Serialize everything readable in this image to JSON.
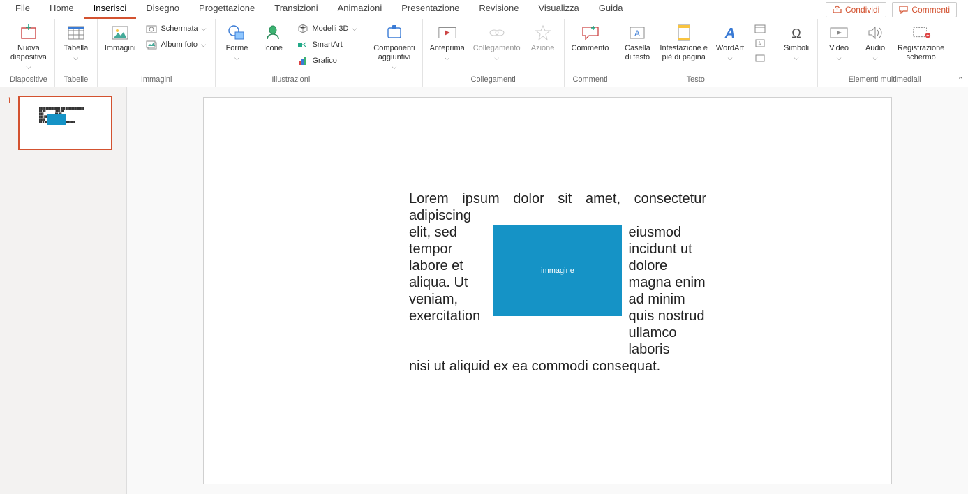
{
  "tabs": {
    "items": [
      "File",
      "Home",
      "Inserisci",
      "Disegno",
      "Progettazione",
      "Transizioni",
      "Animazioni",
      "Presentazione",
      "Revisione",
      "Visualizza",
      "Guida"
    ],
    "active_index": 2
  },
  "share_label": "Condividi",
  "comments_label": "Commenti",
  "ribbon": {
    "groups": {
      "diapositive": {
        "label": "Diapositive",
        "nuova": "Nuova\ndiapositiva"
      },
      "tabelle": {
        "label": "Tabelle",
        "tabella": "Tabella"
      },
      "immagini": {
        "label": "Immagini",
        "immagini": "Immagini",
        "schermata": "Schermata",
        "album": "Album foto"
      },
      "illustrazioni": {
        "label": "Illustrazioni",
        "forme": "Forme",
        "icone": "Icone",
        "modelli3d": "Modelli 3D",
        "smartart": "SmartArt",
        "grafico": "Grafico"
      },
      "componenti": {
        "label": "",
        "componenti": "Componenti\naggiuntivi"
      },
      "collegamenti": {
        "label": "Collegamenti",
        "anteprima": "Anteprima",
        "collegamento": "Collegamento",
        "azione": "Azione"
      },
      "commenti": {
        "label": "Commenti",
        "commento": "Commento"
      },
      "testo": {
        "label": "Testo",
        "casella": "Casella\ndi testo",
        "intestazione": "Intestazione e\npiè di pagina",
        "wordart": "WordArt"
      },
      "simboli": {
        "label": "",
        "simboli": "Simboli"
      },
      "elementi": {
        "label": "Elementi multimediali",
        "video": "Video",
        "audio": "Audio",
        "registrazione": "Registrazione\nschermo"
      }
    }
  },
  "thumbnail": {
    "number": "1"
  },
  "slide": {
    "line1": "Lorem ipsum dolor sit amet, consectetur adipiscing",
    "left_col": "elit, sed tempor labore et aliqua. Ut veniam, exercitation",
    "right_col": "eiusmod incidunt ut dolore magna enim ad minim quis nostrud ullamco laboris",
    "image_label": "immagine",
    "last_line": "nisi ut aliquid ex ea commodi consequat."
  }
}
